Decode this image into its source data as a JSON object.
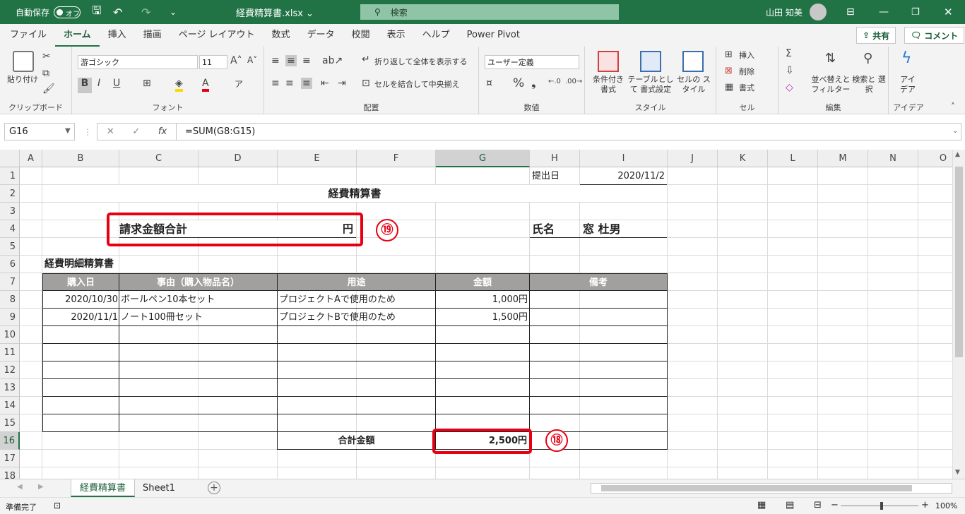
{
  "titlebar": {
    "autosave_label": "自動保存",
    "autosave_state": "オフ",
    "filename": "経費精算書.xlsx ⌄",
    "search_placeholder": "検索",
    "user_name": "山田 知美"
  },
  "tabs": [
    "ファイル",
    "ホーム",
    "挿入",
    "描画",
    "ページ レイアウト",
    "数式",
    "データ",
    "校閲",
    "表示",
    "ヘルプ",
    "Power Pivot"
  ],
  "active_tab": "ホーム",
  "share_label": "共有",
  "comment_label": "コメント",
  "ribbon": {
    "clipboard": {
      "paste": "貼り付け",
      "label": "クリップボード"
    },
    "font": {
      "name": "游ゴシック",
      "size": "11",
      "label": "フォント"
    },
    "alignment": {
      "wrap": "折り返して全体を表示する",
      "merge": "セルを結合して中央揃え",
      "label": "配置"
    },
    "number": {
      "format": "ユーザー定義",
      "label": "数値"
    },
    "styles": {
      "cond": "条件付き 書式",
      "table": "テーブルとして 書式設定",
      "cell": "セルの スタイル",
      "label": "スタイル"
    },
    "cells": {
      "insert": "挿入",
      "delete": "削除",
      "format": "書式",
      "label": "セル"
    },
    "editing": {
      "sort": "並べ替えと フィルター",
      "find": "検索と 選択",
      "label": "編集"
    },
    "ideas": {
      "btn": "アイ デア",
      "label": "アイデア"
    }
  },
  "formula_bar": {
    "name_box": "G16",
    "formula": "=SUM(G8:G15)"
  },
  "columns": [
    "A",
    "B",
    "C",
    "D",
    "E",
    "F",
    "G",
    "H",
    "I",
    "J",
    "K",
    "L",
    "M",
    "N",
    "O"
  ],
  "rows": [
    "1",
    "2",
    "3",
    "4",
    "5",
    "6",
    "7",
    "8",
    "9",
    "10",
    "11",
    "12",
    "13",
    "14",
    "15",
    "16",
    "17",
    "18"
  ],
  "sheet": {
    "submit_label": "提出日",
    "submit_date": "2020/11/2",
    "title": "経費精算書",
    "total_label": "請求金額合計",
    "yen": "円",
    "name_label": "氏名",
    "name_value": "窓 杜男",
    "detail_title": "経費明細精算書",
    "headers": [
      "購入日",
      "事由（購入物品名）",
      "用途",
      "金額",
      "備考"
    ],
    "rows": [
      {
        "date": "2020/10/30",
        "item": "ボールペン10本セット",
        "purpose": "プロジェクトAで使用のため",
        "amount": "1,000円"
      },
      {
        "date": "2020/11/1",
        "item": "ノート100冊セット",
        "purpose": "プロジェクトBで使用のため",
        "amount": "1,500円"
      }
    ],
    "sum_label": "合計金額",
    "sum_value": "2,500円"
  },
  "annotations": {
    "badge_18": "⑱",
    "badge_19": "⑲"
  },
  "sheet_tabs": [
    "経費精算書",
    "Sheet1"
  ],
  "status": {
    "ready": "準備完了",
    "zoom": "100%"
  },
  "colors": {
    "accent": "#217346",
    "highlight": "#e60012",
    "table_header": "#a29f9f"
  }
}
